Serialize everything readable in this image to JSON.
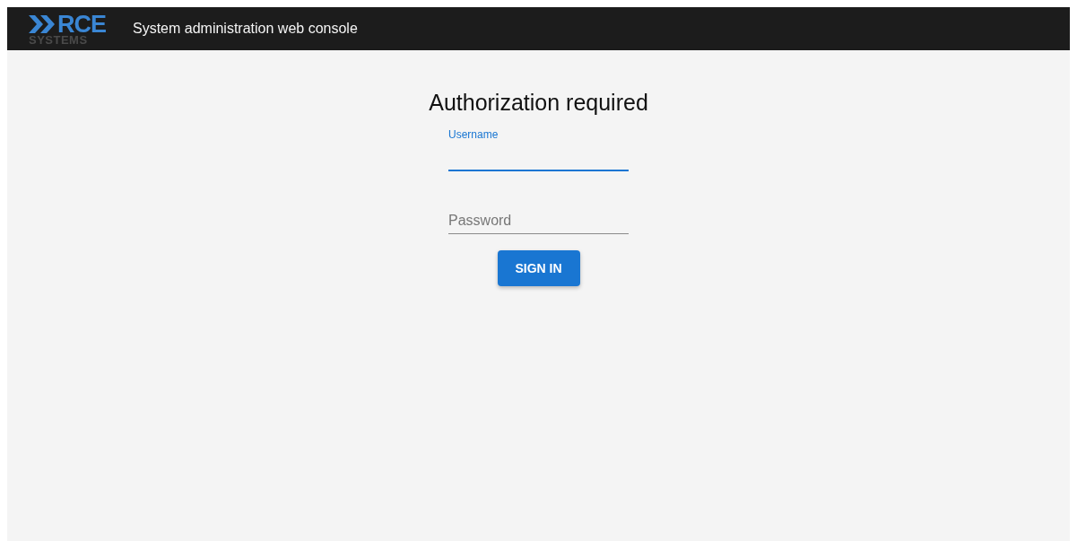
{
  "header": {
    "logo": {
      "top": "RCE",
      "bottom": "SYSTEMS"
    },
    "title": "System administration web console"
  },
  "login": {
    "heading": "Authorization required",
    "fields": [
      {
        "label": "Username",
        "focused": true
      },
      {
        "label": "Password",
        "focused": false
      }
    ],
    "button": "SIGN IN"
  }
}
